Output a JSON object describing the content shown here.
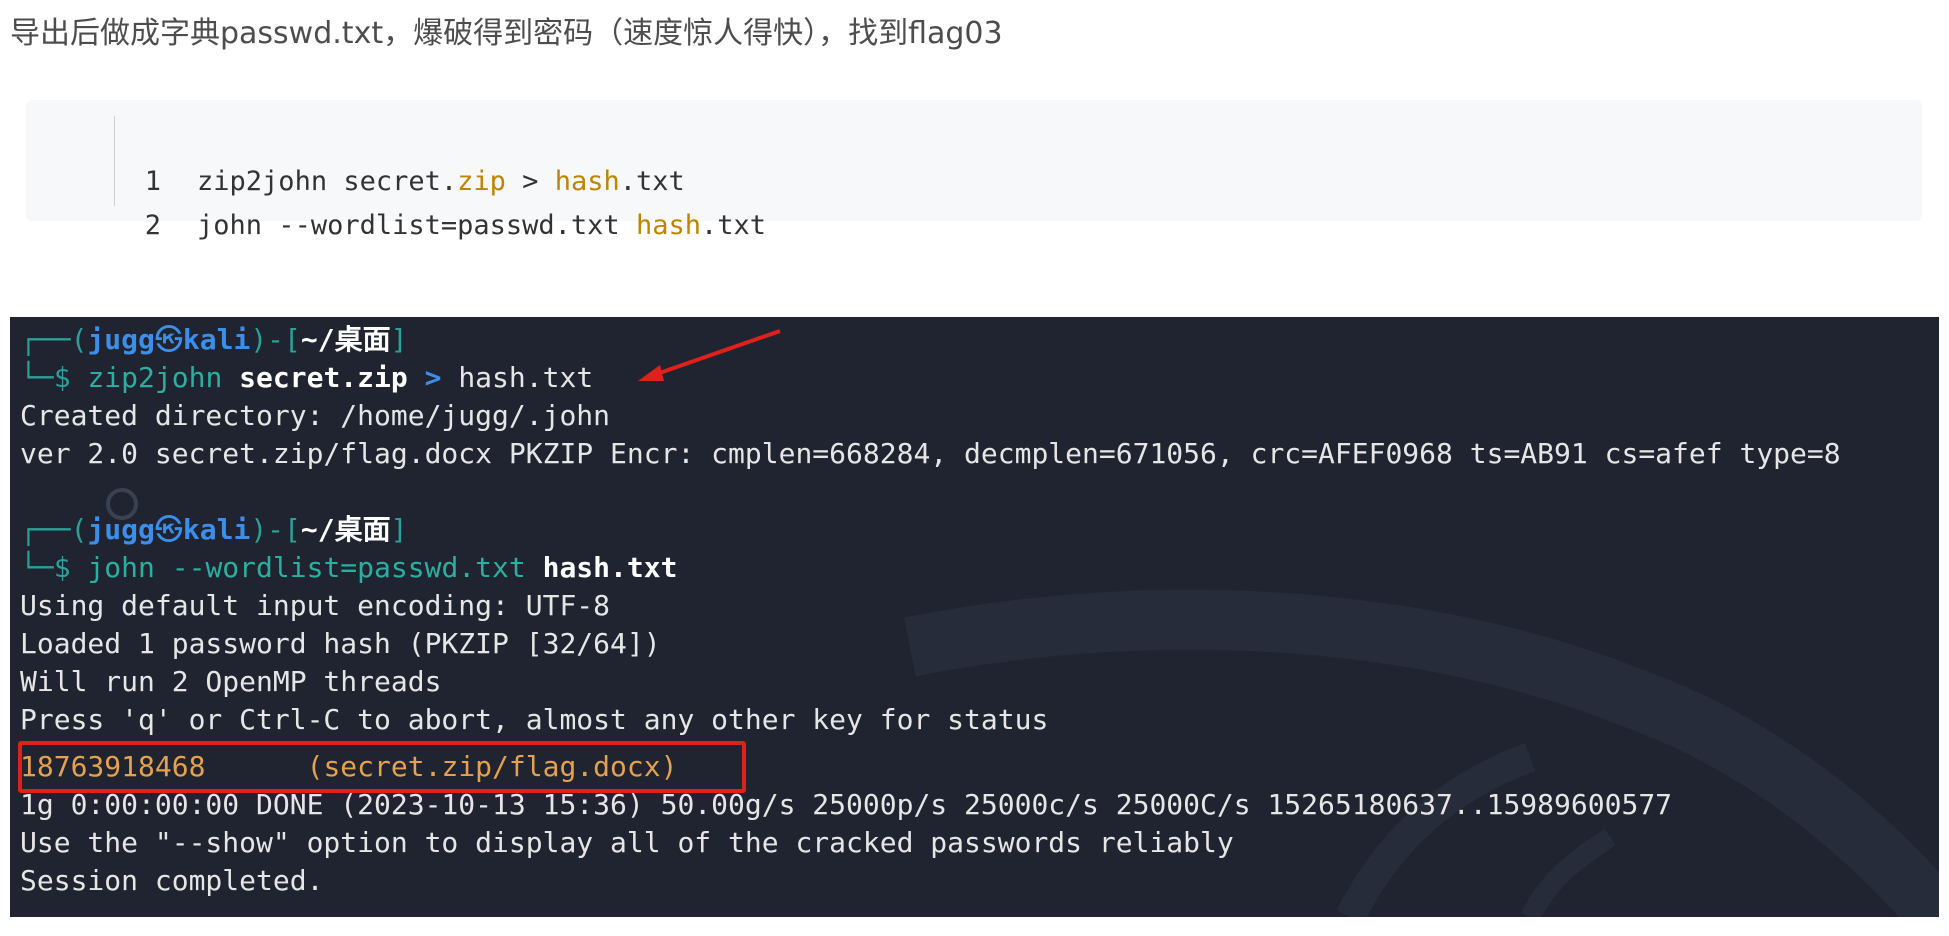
{
  "intro": {
    "text": "导出后做成字典passwd.txt，爆破得到密码（速度惊人得快），找到flag03"
  },
  "code": {
    "lines": [
      {
        "num": "1",
        "pre": "zip2john secret.",
        "kw1": "zip",
        "mid": " > ",
        "kw2": "hash",
        "post": ".txt"
      },
      {
        "num": "2",
        "pre": "john --wordlist=passwd.txt ",
        "kw1": "hash",
        "mid": "",
        "kw2": "",
        "post": ".txt"
      }
    ]
  },
  "terminal": {
    "prompt1": {
      "open": "┌──(",
      "user": "jugg",
      "at": "㉿",
      "host": "kali",
      "mid": ")-[",
      "path": "~/桌面",
      "close": "]"
    },
    "cmd1": {
      "prefix": "└─$ ",
      "cmd": "zip2john ",
      "arg": "secret.zip",
      "op": " > ",
      "rest": "hash.txt"
    },
    "out1": [
      "Created directory: /home/jugg/.john",
      "ver 2.0 secret.zip/flag.docx PKZIP Encr: cmplen=668284, decmplen=671056, crc=AFEF0968 ts=AB91 cs=afef type=8"
    ],
    "prompt2": {
      "open": "┌──(",
      "user": "jugg",
      "at": "㉿",
      "host": "kali",
      "mid": ")-[",
      "path": "~/桌面",
      "close": "]"
    },
    "cmd2": {
      "prefix": "└─$ ",
      "cmd": "john --wordlist=passwd.txt ",
      "arg": "hash.txt"
    },
    "out2": [
      "Using default input encoding: UTF-8",
      "Loaded 1 password hash (PKZIP [32/64])",
      "Will run 2 OpenMP threads",
      "Press 'q' or Ctrl-C to abort, almost any other key for status"
    ],
    "cracked": {
      "password": "18763918468",
      "gap": "      ",
      "open": "(",
      "file": "secret.zip/flag.docx",
      "close": ")"
    },
    "out3": [
      "1g 0:00:00:00 DONE (2023-10-13 15:36) 50.00g/s 25000p/s 25000c/s 25000C/s 15265180637..15989600577",
      "Use the \"--show\" option to display all of the cracked passwords reliably",
      "Session completed."
    ],
    "colors": {
      "background": "#1f2430",
      "highlight": "#e0201b",
      "arrow": "#e0201b",
      "password": "#e5a14b"
    }
  }
}
